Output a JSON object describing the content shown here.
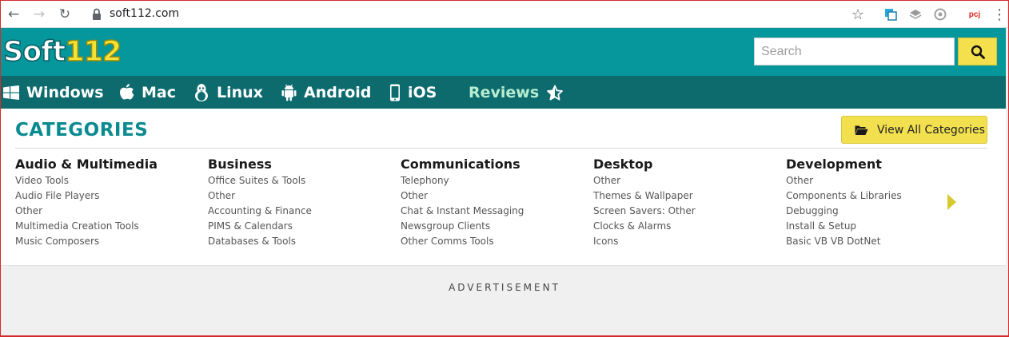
{
  "browser": {
    "url": "soft112.com",
    "back_icon": "←",
    "forward_icon": "→",
    "reload_icon": "↻",
    "star_icon": "☆",
    "menu_icon": "⋮",
    "extension_badge": "pcj"
  },
  "header": {
    "logo_soft": "Soft",
    "logo_num": "112",
    "search_placeholder": "Search"
  },
  "nav": {
    "items": [
      {
        "label": "Windows",
        "icon": "windows-icon"
      },
      {
        "label": "Mac",
        "icon": "apple-icon"
      },
      {
        "label": "Linux",
        "icon": "linux-icon"
      },
      {
        "label": "Android",
        "icon": "android-icon"
      },
      {
        "label": "iOS",
        "icon": "phone-icon"
      },
      {
        "label": "Reviews",
        "icon": "star-icon"
      }
    ]
  },
  "categories": {
    "title": "CATEGORIES",
    "view_all_label": "View All Categories",
    "columns": [
      {
        "heading": "Audio & Multimedia",
        "links": [
          "Video Tools",
          "Audio File Players",
          "Other",
          "Multimedia Creation Tools",
          "Music Composers"
        ]
      },
      {
        "heading": "Business",
        "links": [
          "Office Suites & Tools",
          "Other",
          "Accounting & Finance",
          "PIMS & Calendars",
          "Databases & Tools"
        ]
      },
      {
        "heading": "Communications",
        "links": [
          "Telephony",
          "Other",
          "Chat & Instant Messaging",
          "Newsgroup Clients",
          "Other Comms Tools"
        ]
      },
      {
        "heading": "Desktop",
        "links": [
          "Other",
          "Themes & Wallpaper",
          "Screen Savers: Other",
          "Clocks & Alarms",
          "Icons"
        ]
      },
      {
        "heading": "Development",
        "links": [
          "Other",
          "Components & Libraries",
          "Debugging",
          "Install & Setup",
          "Basic VB VB DotNet"
        ]
      }
    ]
  },
  "advertisement_label": "ADVERTISEMENT",
  "colors": {
    "header_teal": "#05979b",
    "nav_dark_teal": "#0d6b6e",
    "accent_yellow": "#f2e04f",
    "title_teal": "#0a8b8f"
  }
}
